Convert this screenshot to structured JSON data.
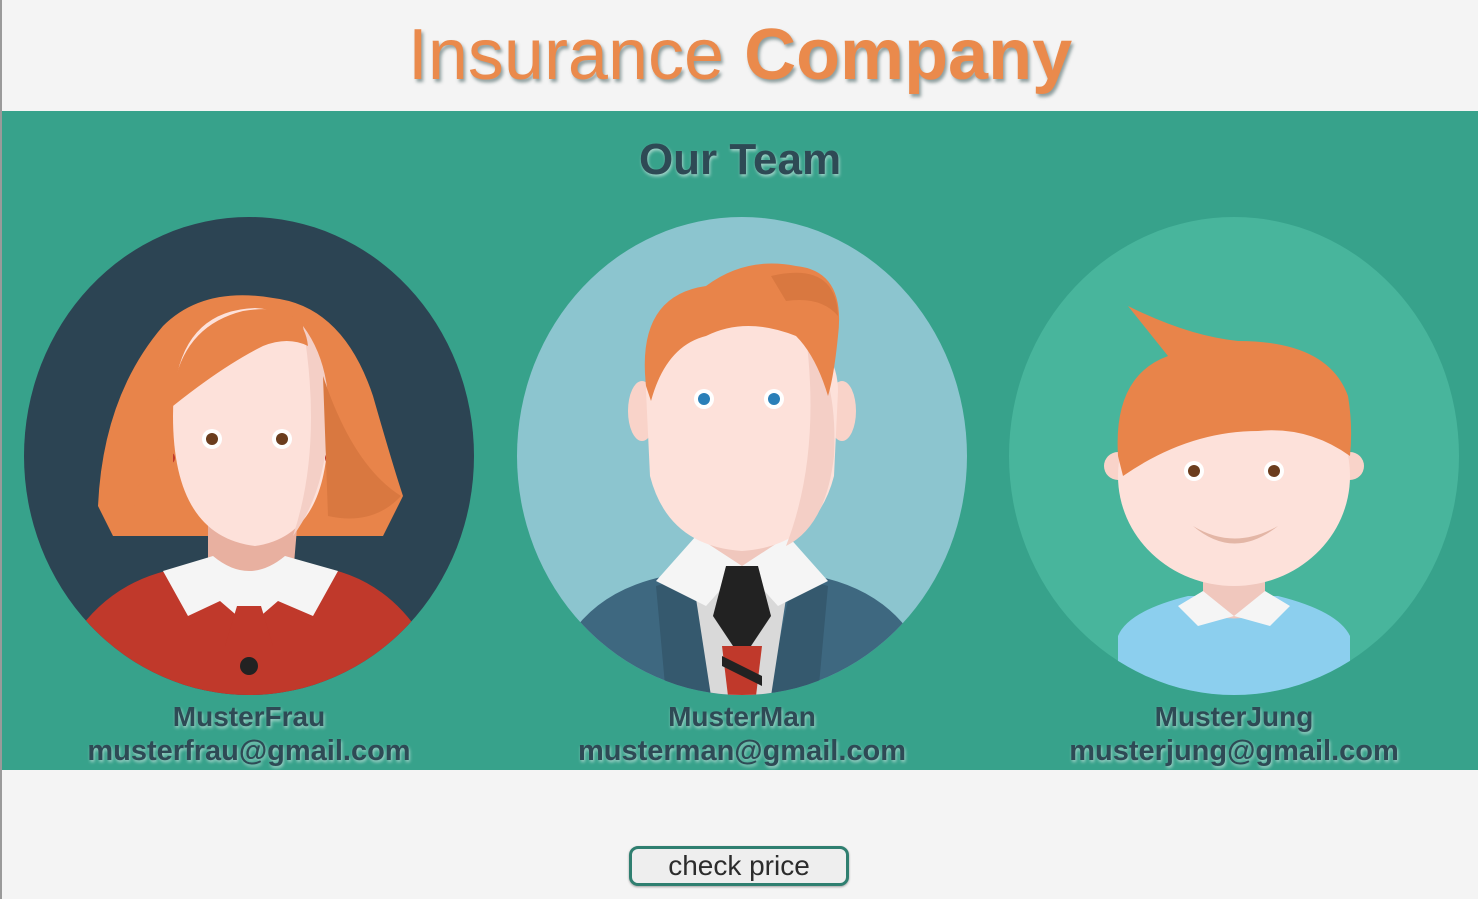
{
  "header": {
    "title_part1": "Insurance",
    "title_part2": "Company"
  },
  "team": {
    "title": "Our Team",
    "members": [
      {
        "name": "MusterFrau",
        "email": "musterfrau@gmail.com",
        "avatar": "woman-avatar-icon"
      },
      {
        "name": "MusterMan",
        "email": "musterman@gmail.com",
        "avatar": "man-avatar-icon"
      },
      {
        "name": "MusterJung",
        "email": "musterjung@gmail.com",
        "avatar": "boy-avatar-icon"
      }
    ]
  },
  "actions": {
    "check_price_label": "check price"
  },
  "colors": {
    "brand_orange": "#ea8a4c",
    "team_bg": "#37a28b",
    "text_dark": "#2e4a55",
    "button_border": "#2f7f70"
  }
}
